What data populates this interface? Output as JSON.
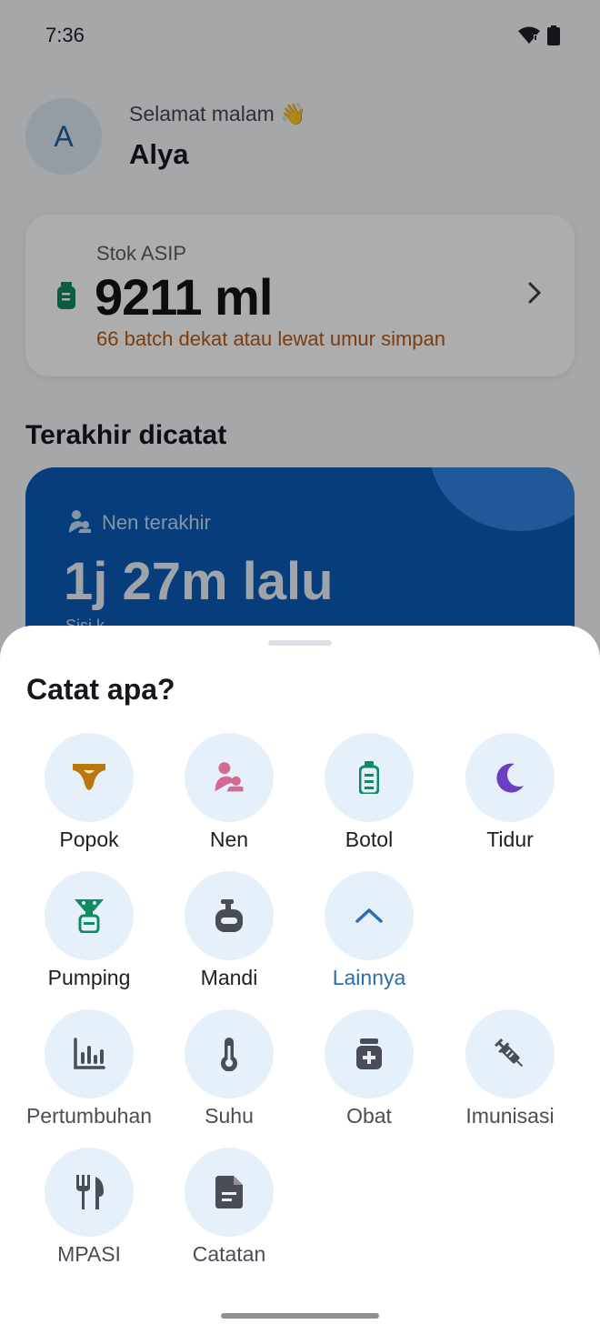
{
  "status_bar": {
    "time": "7:36"
  },
  "header": {
    "avatar_initial": "A",
    "greeting": "Selamat malam 👋",
    "user_name": "Alya"
  },
  "stock_card": {
    "label": "Stok ASIP",
    "value": "9211 ml",
    "warning": "66 batch dekat atau lewat umur simpan"
  },
  "recent": {
    "title": "Terakhir dicatat",
    "card_label": "Nen terakhir",
    "card_value": "1j 27m lalu",
    "card_sub": "Sisi k"
  },
  "sheet": {
    "title": "Catat apa?",
    "items": [
      {
        "label": "Popok",
        "icon": "diaper-icon",
        "color": "#b8770f"
      },
      {
        "label": "Nen",
        "icon": "nursing-icon",
        "color": "#d26b92"
      },
      {
        "label": "Botol",
        "icon": "bottle-icon",
        "color": "#0f8a63"
      },
      {
        "label": "Tidur",
        "icon": "moon-icon",
        "color": "#6b3fc2"
      },
      {
        "label": "Pumping",
        "icon": "pump-icon",
        "color": "#0f8a63"
      },
      {
        "label": "Mandi",
        "icon": "soap-icon",
        "color": "#4a4d55"
      },
      {
        "label": "Lainnya",
        "icon": "chevron-up-icon",
        "color": "#2c6cb3"
      },
      {
        "label": "Pertumbuhan",
        "icon": "chart-icon",
        "color": "#4a4d55"
      },
      {
        "label": "Suhu",
        "icon": "thermometer-icon",
        "color": "#4a4d55"
      },
      {
        "label": "Obat",
        "icon": "medicine-icon",
        "color": "#4a4d55"
      },
      {
        "label": "Imunisasi",
        "icon": "syringe-icon",
        "color": "#4a4d55"
      },
      {
        "label": "MPASI",
        "icon": "cutlery-icon",
        "color": "#4a4d55"
      },
      {
        "label": "Catatan",
        "icon": "note-icon",
        "color": "#4a4d55"
      }
    ]
  }
}
